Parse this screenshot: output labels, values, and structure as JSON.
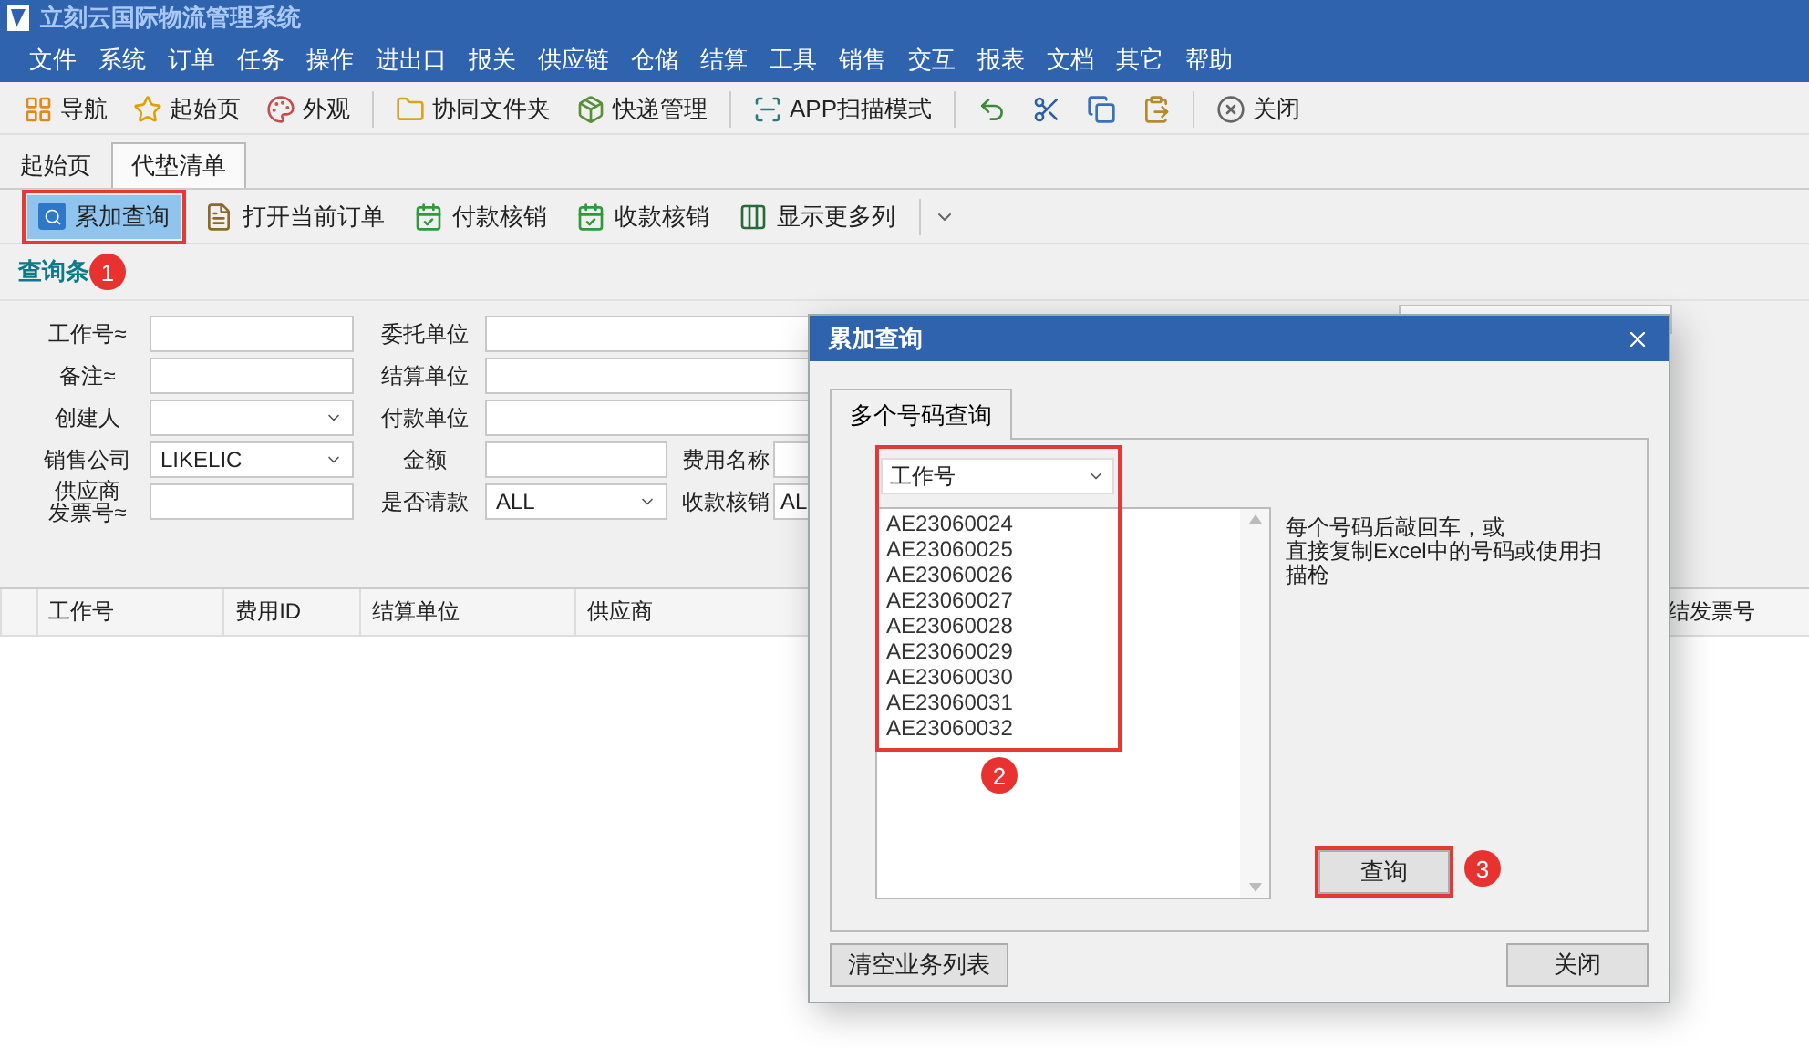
{
  "app": {
    "title": "立刻云国际物流管理系统"
  },
  "menu": [
    "文件",
    "系统",
    "订单",
    "任务",
    "操作",
    "进出口",
    "报关",
    "供应链",
    "仓储",
    "结算",
    "工具",
    "销售",
    "交互",
    "报表",
    "文档",
    "其它",
    "帮助"
  ],
  "toolbar": [
    [
      {
        "kind": "nav",
        "label": "导航"
      },
      {
        "kind": "star",
        "label": "起始页"
      },
      {
        "kind": "palette",
        "label": "外观"
      }
    ],
    [
      {
        "kind": "folder",
        "label": "协同文件夹"
      },
      {
        "kind": "parcel",
        "label": "快递管理"
      }
    ],
    [
      {
        "kind": "scan",
        "label": "APP扫描模式"
      }
    ],
    [
      {
        "kind": "undo"
      },
      {
        "kind": "cut"
      },
      {
        "kind": "copy"
      },
      {
        "kind": "paste"
      }
    ],
    [
      {
        "kind": "close",
        "label": "关闭"
      }
    ]
  ],
  "tabs": [
    {
      "label": "起始页",
      "selected": false
    },
    {
      "label": "代垫清单",
      "selected": true
    }
  ],
  "actions": [
    {
      "kind": "search",
      "label": "累加查询",
      "selected": true
    },
    {
      "kind": "document",
      "label": "打开当前订单",
      "selected": false
    },
    {
      "kind": "calendar",
      "label": "付款核销",
      "selected": false
    },
    {
      "kind": "calendar",
      "label": "收款核销",
      "selected": false
    },
    {
      "kind": "columns",
      "label": "显示更多列",
      "selected": false
    }
  ],
  "query_section": {
    "title": "查询条",
    "badge": "1"
  },
  "filters": [
    [
      {
        "label": "工作号≈",
        "kind": "text"
      },
      {
        "label": "委托单位",
        "kind": "text"
      }
    ],
    [
      {
        "label": "备注≈",
        "kind": "text"
      },
      {
        "label": "结算单位",
        "kind": "text"
      }
    ],
    [
      {
        "label": "创建人",
        "kind": "select"
      },
      {
        "label": "付款单位",
        "kind": "text"
      }
    ],
    [
      {
        "label": "销售公司",
        "kind": "select",
        "value": "LIKELIC"
      },
      {
        "label": "金额",
        "kind": "text"
      },
      {
        "label": "费用名称",
        "kind": "text"
      }
    ],
    [
      {
        "label": [
          "供应商",
          "发票号≈"
        ],
        "kind": "text"
      },
      {
        "label": "是否请款",
        "kind": "select",
        "value": "ALL"
      },
      {
        "label": "收款核销",
        "kind": "select",
        "value": "AL"
      }
    ]
  ],
  "table": {
    "columns": [
      "工作号",
      "费用ID",
      "结算单位",
      "供应商",
      "结发票号"
    ]
  },
  "dialog": {
    "title": "累加查询",
    "tabs": [
      {
        "label": "多个号码查询",
        "selected": true
      }
    ],
    "field_select": "工作号",
    "numbers": [
      "AE23060024",
      "AE23060025",
      "AE23060026",
      "AE23060027",
      "AE23060028",
      "AE23060029",
      "AE23060030",
      "AE23060031",
      "AE23060032"
    ],
    "hint": [
      "每个号码后敲回车，或",
      "直接复制Excel中的号码或使用扫描枪"
    ],
    "query_button": "查询",
    "clear_button": "清空业务列表",
    "close_button": "关闭",
    "badges": [
      "2",
      "3"
    ]
  }
}
